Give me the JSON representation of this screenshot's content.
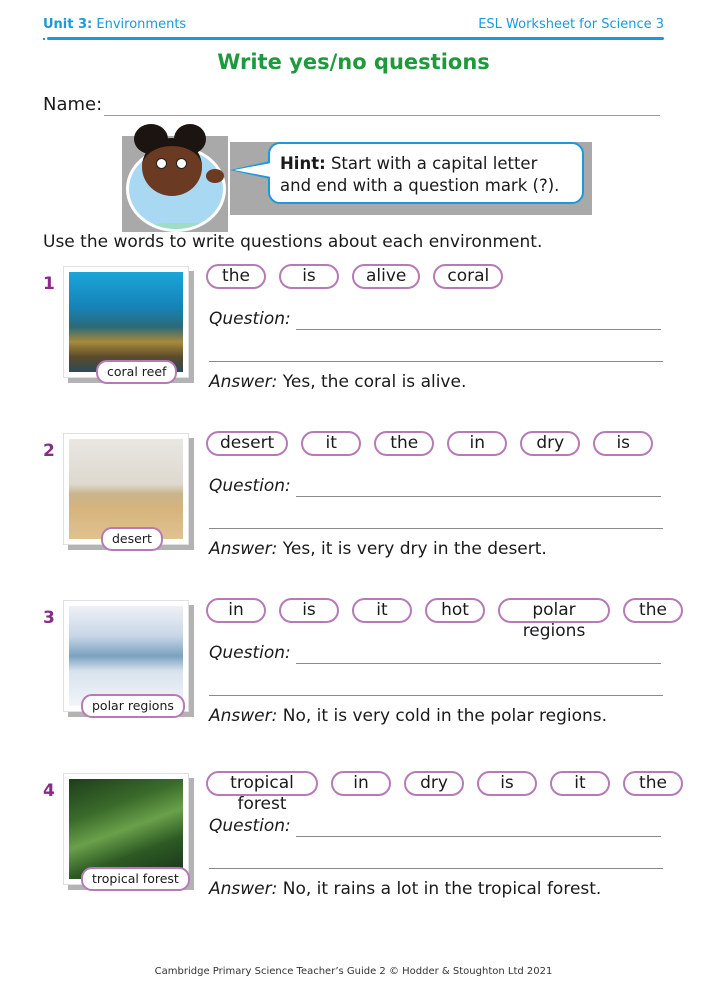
{
  "header": {
    "unit_label": "Unit 3:",
    "unit_name": "Environments",
    "series": "ESL Worksheet for Science 3"
  },
  "title": "Write yes/no questions",
  "name_label": "Name:",
  "hint": {
    "label": "Hint:",
    "text": "Start with a capital letter and end with a question mark (?)."
  },
  "instruction": "Use the words to write questions about each environment.",
  "question_label": "Question:",
  "answer_label": "Answer:",
  "exercises": [
    {
      "number": "1",
      "photo_label": "coral reef",
      "photo_icon": "coral-reef-photo",
      "words": [
        "the",
        "is",
        "alive",
        "coral"
      ],
      "answer": "Yes, the coral is alive."
    },
    {
      "number": "2",
      "photo_label": "desert",
      "photo_icon": "desert-photo",
      "words": [
        "desert",
        "it",
        "the",
        "in",
        "dry",
        "is"
      ],
      "answer": "Yes, it is very dry in the desert."
    },
    {
      "number": "3",
      "photo_label": "polar regions",
      "photo_icon": "polar-regions-photo",
      "words": [
        "in",
        "is",
        "it",
        "hot",
        "polar regions",
        "the"
      ],
      "answer": "No, it is very cold in the polar regions."
    },
    {
      "number": "4",
      "photo_label": "tropical forest",
      "photo_icon": "tropical-forest-photo",
      "words": [
        "tropical forest",
        "in",
        "dry",
        "is",
        "it",
        "the"
      ],
      "answer": "No, it rains a lot in the tropical forest."
    }
  ],
  "footer": "Cambridge Primary Science Teacher’s Guide 2 © Hodder & Stoughton Ltd 2021",
  "colors": {
    "header_blue": "#1a9ad9",
    "title_green": "#1e9a3c",
    "number_purple": "#8a2a8a",
    "pill_border": "#b67ab6"
  }
}
